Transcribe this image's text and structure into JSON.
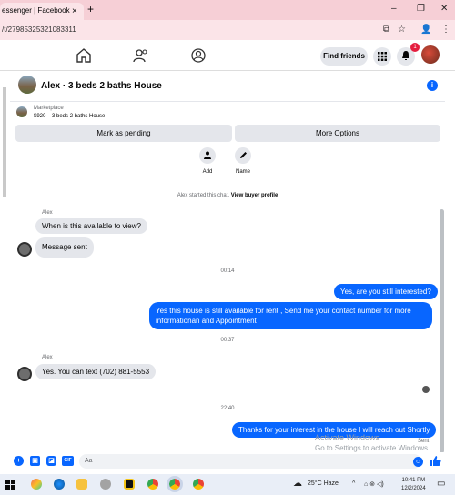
{
  "browser": {
    "tab_title": "essenger | Facebook",
    "tab_close": "×",
    "new_tab": "+",
    "url": "/t/27985325321083311",
    "window_controls": [
      "–",
      "❐",
      "✕"
    ],
    "address_icons": [
      "⧉",
      "☆",
      "👤",
      "⋮"
    ]
  },
  "fbnav": {
    "icons": [
      "home-icon",
      "friends-icon",
      "groups-icon"
    ],
    "find_friends": "Find friends",
    "notif_badge": "1"
  },
  "chat": {
    "title": "Alex · 3 beds 2 baths House",
    "info_icon": "i",
    "marketplace_label": "Marketplace",
    "listing": "$920 – 3 beds 2 baths House",
    "mark_pending": "Mark as pending",
    "more_options": "More Options",
    "add_label": "Add",
    "name_label": "Name",
    "started_prefix": "Alex started this chat.",
    "view_profile": "View buyer profile"
  },
  "messages": {
    "sender1": "Alex",
    "m1": "When is this available to view?",
    "m2": "Message sent",
    "time1": "00:14",
    "out1": "Yes, are you still interested?",
    "out2": "Yes this house is still available for rent , Send me your contact number for more informationan and Appointment",
    "time2": "00:37",
    "sender2": "Alex",
    "m3": "Yes. You can text (702) 881-5553",
    "time3": "22:40",
    "out3": "Thanks for your interest in the house I will reach out Shortly",
    "sent_label": "Sent"
  },
  "composer": {
    "placeholder": "Aa",
    "icons": [
      "plus-icon",
      "image-icon",
      "sticker-icon",
      "gif-icon"
    ],
    "gif_label": "GIF"
  },
  "watermark": {
    "line1": "Activate Windows",
    "line2": "Go to Settings to activate Windows."
  },
  "taskbar": {
    "weather": "25°C  Haze",
    "time": "10:41 PM",
    "date": "12/2/2024"
  }
}
